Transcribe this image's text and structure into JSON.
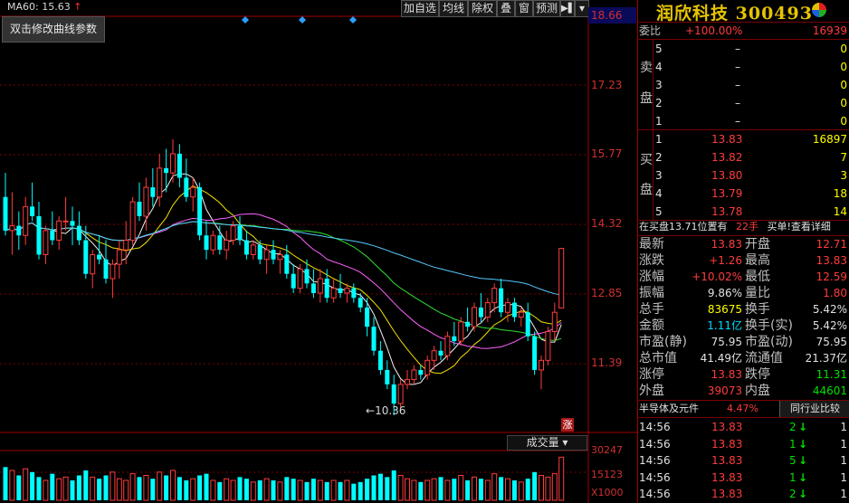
{
  "toolbar": {
    "ma_label": "MA60: 15.63",
    "ma_arrow": "↑",
    "buttons": [
      "加自选",
      "均线",
      "除权",
      "叠",
      "窗",
      "预测"
    ],
    "menu_icon": "▶▌",
    "dropdown_icon": "▾"
  },
  "popup_text": "双击修改曲线参数",
  "price_axis": [
    "18.66",
    "17.23",
    "15.77",
    "14.32",
    "12.85",
    "11.39"
  ],
  "low_marker": "10.36",
  "volume_axis": [
    "30247",
    "15123",
    "X1000"
  ],
  "volume_selector": "成交量",
  "limit_badge": "涨",
  "stock": {
    "name": "润欣科技",
    "code": "300493"
  },
  "weibi": {
    "label": "委比",
    "pct": "+100.00%",
    "diff": "16939"
  },
  "sell_label": [
    "卖",
    "盘"
  ],
  "buy_label": [
    "买",
    "盘"
  ],
  "asks": [
    {
      "level": "5",
      "price": "–",
      "vol": "0"
    },
    {
      "level": "4",
      "price": "–",
      "vol": "0"
    },
    {
      "level": "3",
      "price": "–",
      "vol": "0"
    },
    {
      "level": "2",
      "price": "–",
      "vol": "0"
    },
    {
      "level": "1",
      "price": "–",
      "vol": "0"
    }
  ],
  "bids": [
    {
      "level": "1",
      "price": "13.83",
      "vol": "16897"
    },
    {
      "level": "2",
      "price": "13.82",
      "vol": "7"
    },
    {
      "level": "3",
      "price": "13.80",
      "vol": "3"
    },
    {
      "level": "4",
      "price": "13.79",
      "vol": "18"
    },
    {
      "level": "5",
      "price": "13.78",
      "vol": "14"
    }
  ],
  "buy_notice": {
    "text": "在买盘13.71位置有",
    "qty": "22手",
    "link": "买单!查看详细"
  },
  "quote": [
    {
      "l1": "最新",
      "v1": "13.83",
      "c1": "red",
      "l2": "开盘",
      "v2": "12.71",
      "c2": "red"
    },
    {
      "l1": "涨跌",
      "v1": "+1.26",
      "c1": "red",
      "l2": "最高",
      "v2": "13.83",
      "c2": "red"
    },
    {
      "l1": "涨幅",
      "v1": "+10.02%",
      "c1": "red",
      "l2": "最低",
      "v2": "12.59",
      "c2": "red"
    },
    {
      "l1": "振幅",
      "v1": "9.86%",
      "c1": "wht",
      "l2": "量比",
      "v2": "1.80",
      "c2": "red"
    },
    {
      "l1": "总手",
      "v1": "83675",
      "c1": "yel",
      "l2": "换手",
      "v2": "5.42%",
      "c2": "wht"
    },
    {
      "l1": "金额",
      "v1": "1.11亿",
      "c1": "cyan",
      "l2": "换手(实)",
      "v2": "5.42%",
      "c2": "wht"
    },
    {
      "l1": "市盈(静)",
      "v1": "75.95",
      "c1": "wht",
      "l2": "市盈(动)",
      "v2": "75.95",
      "c2": "wht"
    },
    {
      "l1": "总市值",
      "v1": "41.49亿",
      "c1": "wht",
      "l2": "流通值",
      "v2": "21.37亿",
      "c2": "wht"
    },
    {
      "l1": "涨停",
      "v1": "13.83",
      "c1": "red",
      "l2": "跌停",
      "v2": "11.31",
      "c2": "grn"
    },
    {
      "l1": "外盘",
      "v1": "39073",
      "c1": "red",
      "l2": "内盘",
      "v2": "44601",
      "c2": "grn"
    }
  ],
  "sector": {
    "name": "半导体及元件",
    "pct": "4.47%",
    "compare": "同行业比较"
  },
  "ticks": [
    {
      "time": "14:56",
      "price": "13.83",
      "vol": "2",
      "dir": "down",
      "count": "1"
    },
    {
      "time": "14:56",
      "price": "13.83",
      "vol": "1",
      "dir": "down",
      "count": "1"
    },
    {
      "time": "14:56",
      "price": "13.83",
      "vol": "5",
      "dir": "down",
      "count": "1"
    },
    {
      "time": "14:56",
      "price": "13.83",
      "vol": "1",
      "dir": "down",
      "count": "1"
    },
    {
      "time": "14:56",
      "price": "13.83",
      "vol": "2",
      "dir": "down",
      "count": "1"
    }
  ],
  "colors": {
    "up": "#ff3c3c",
    "down": "#00ffff",
    "gold": "#e7c400",
    "grid": "#7a0000"
  },
  "chart_data": {
    "type": "candlestick",
    "ylim": [
      10.0,
      18.66
    ],
    "low_value": 10.36,
    "candles": [
      [
        14.9,
        15.4,
        14.1,
        14.2
      ],
      [
        14.2,
        15.0,
        13.7,
        14.3
      ],
      [
        14.3,
        14.6,
        13.8,
        14.1
      ],
      [
        14.1,
        14.9,
        13.9,
        14.7
      ],
      [
        14.7,
        15.2,
        14.4,
        14.5
      ],
      [
        14.5,
        14.8,
        13.6,
        13.7
      ],
      [
        13.7,
        14.3,
        13.5,
        14.2
      ],
      [
        14.2,
        14.6,
        13.9,
        14.0
      ],
      [
        14.0,
        14.5,
        13.8,
        14.4
      ],
      [
        14.4,
        14.9,
        14.2,
        14.4
      ],
      [
        14.4,
        14.7,
        13.9,
        14.3
      ],
      [
        14.3,
        14.6,
        13.9,
        14.0
      ],
      [
        14.0,
        14.3,
        13.2,
        13.3
      ],
      [
        13.3,
        13.8,
        13.0,
        13.7
      ],
      [
        13.7,
        14.1,
        13.5,
        13.6
      ],
      [
        13.6,
        14.0,
        13.1,
        13.2
      ],
      [
        13.2,
        13.6,
        12.8,
        13.5
      ],
      [
        13.5,
        14.0,
        13.2,
        13.8
      ],
      [
        13.8,
        14.4,
        13.5,
        14.0
      ],
      [
        14.0,
        14.9,
        13.9,
        14.8
      ],
      [
        14.8,
        15.2,
        14.4,
        14.5
      ],
      [
        14.5,
        15.3,
        14.2,
        15.1
      ],
      [
        15.1,
        15.5,
        14.7,
        14.9
      ],
      [
        14.9,
        15.8,
        14.7,
        15.5
      ],
      [
        15.5,
        15.9,
        15.0,
        15.4
      ],
      [
        15.4,
        16.1,
        15.2,
        15.8
      ],
      [
        15.8,
        16.0,
        15.1,
        15.3
      ],
      [
        15.3,
        15.7,
        14.8,
        14.9
      ],
      [
        14.9,
        15.3,
        14.6,
        15.1
      ],
      [
        15.1,
        15.2,
        14.0,
        14.1
      ],
      [
        14.1,
        14.4,
        13.6,
        13.8
      ],
      [
        13.8,
        14.2,
        13.7,
        14.1
      ],
      [
        14.1,
        14.3,
        13.7,
        13.8
      ],
      [
        13.8,
        14.2,
        13.6,
        14.0
      ],
      [
        14.0,
        14.4,
        13.9,
        14.3
      ],
      [
        14.3,
        14.5,
        13.9,
        14.0
      ],
      [
        14.0,
        14.2,
        13.6,
        13.7
      ],
      [
        13.7,
        14.0,
        13.6,
        13.9
      ],
      [
        13.9,
        14.0,
        13.5,
        13.6
      ],
      [
        13.6,
        13.9,
        13.3,
        13.8
      ],
      [
        13.8,
        14.0,
        13.5,
        13.6
      ],
      [
        13.6,
        13.8,
        13.3,
        13.7
      ],
      [
        13.7,
        13.9,
        13.2,
        13.3
      ],
      [
        13.3,
        13.5,
        12.9,
        13.0
      ],
      [
        13.0,
        13.5,
        12.9,
        13.4
      ],
      [
        13.4,
        13.6,
        13.0,
        13.1
      ],
      [
        13.1,
        13.4,
        12.8,
        12.9
      ],
      [
        12.9,
        13.4,
        12.7,
        13.2
      ],
      [
        13.2,
        13.4,
        12.7,
        12.8
      ],
      [
        12.8,
        13.2,
        12.7,
        13.0
      ],
      [
        13.0,
        13.3,
        12.8,
        12.9
      ],
      [
        12.9,
        13.1,
        12.7,
        13.0
      ],
      [
        13.0,
        13.1,
        12.7,
        12.8
      ],
      [
        12.8,
        12.9,
        12.5,
        12.6
      ],
      [
        12.6,
        12.8,
        12.0,
        12.2
      ],
      [
        12.2,
        12.4,
        11.6,
        11.7
      ],
      [
        11.7,
        11.9,
        11.2,
        11.3
      ],
      [
        11.3,
        11.5,
        10.9,
        11.0
      ],
      [
        11.0,
        11.2,
        10.36,
        10.6
      ],
      [
        10.6,
        11.1,
        10.5,
        11.0
      ],
      [
        11.0,
        11.3,
        10.9,
        11.1
      ],
      [
        11.1,
        11.4,
        11.0,
        11.3
      ],
      [
        11.3,
        11.4,
        11.1,
        11.2
      ],
      [
        11.2,
        11.6,
        11.1,
        11.5
      ],
      [
        11.5,
        11.8,
        11.3,
        11.7
      ],
      [
        11.7,
        11.9,
        11.5,
        11.6
      ],
      [
        11.6,
        12.1,
        11.5,
        12.0
      ],
      [
        12.0,
        12.3,
        11.8,
        11.9
      ],
      [
        11.9,
        12.4,
        11.8,
        12.3
      ],
      [
        12.3,
        12.6,
        12.1,
        12.2
      ],
      [
        12.2,
        12.7,
        12.1,
        12.6
      ],
      [
        12.6,
        12.9,
        12.3,
        12.4
      ],
      [
        12.4,
        12.8,
        12.3,
        12.7
      ],
      [
        12.7,
        13.1,
        12.5,
        13.0
      ],
      [
        13.0,
        13.2,
        12.4,
        12.5
      ],
      [
        12.5,
        12.8,
        12.3,
        12.7
      ],
      [
        12.7,
        12.8,
        12.3,
        12.4
      ],
      [
        12.4,
        12.6,
        12.2,
        12.5
      ],
      [
        12.5,
        12.7,
        11.9,
        12.0
      ],
      [
        12.0,
        12.1,
        11.2,
        11.3
      ],
      [
        11.3,
        11.6,
        10.9,
        11.5
      ],
      [
        11.5,
        12.2,
        11.4,
        12.1
      ],
      [
        12.1,
        12.7,
        11.9,
        12.5
      ],
      [
        12.59,
        13.83,
        12.59,
        13.83
      ]
    ],
    "volumes": [
      20,
      18,
      15,
      19,
      17,
      14,
      12,
      16,
      13,
      14,
      12,
      15,
      18,
      14,
      13,
      15,
      17,
      13,
      12,
      16,
      14,
      15,
      13,
      17,
      15,
      18,
      14,
      12,
      13,
      15,
      16,
      12,
      11,
      13,
      12,
      14,
      13,
      11,
      12,
      13,
      12,
      11,
      14,
      13,
      12,
      11,
      13,
      12,
      11,
      12,
      11,
      12,
      10,
      11,
      13,
      15,
      16,
      14,
      18,
      15,
      13,
      12,
      11,
      12,
      13,
      14,
      12,
      13,
      15,
      12,
      14,
      13,
      12,
      16,
      14,
      13,
      12,
      11,
      13,
      17,
      15,
      14,
      16,
      26
    ]
  }
}
